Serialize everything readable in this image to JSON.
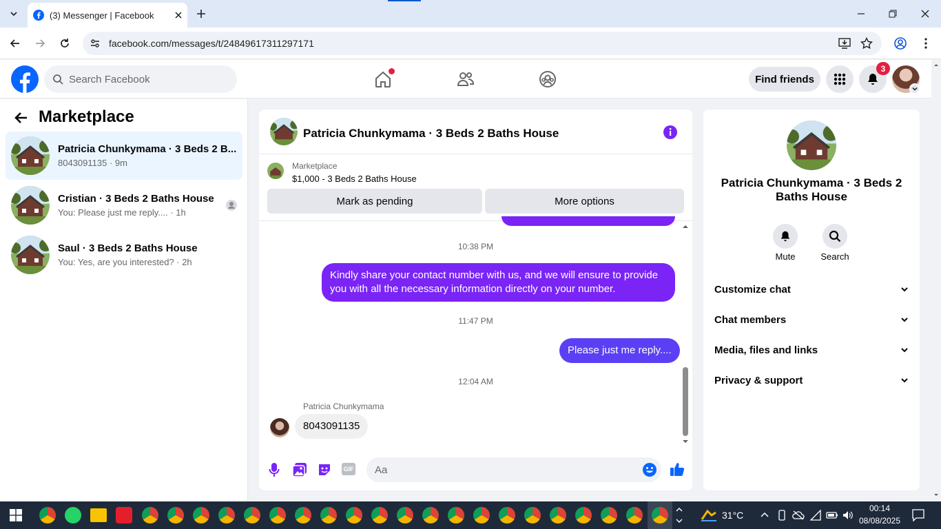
{
  "browser": {
    "tab_title": "(3) Messenger | Facebook",
    "url": "facebook.com/messages/t/24849617311297171"
  },
  "header": {
    "search_placeholder": "Search Facebook",
    "find_friends": "Find friends",
    "notification_count": "3"
  },
  "sidebar": {
    "title": "Marketplace",
    "conversations": [
      {
        "title": "Patricia Chunkymama · 3 Beds 2 B...",
        "subtitle": "8043091135 · 9m"
      },
      {
        "title": "Cristian · 3 Beds 2 Baths House",
        "subtitle": "You: Please just me reply.... · 1h"
      },
      {
        "title": "Saul · 3 Beds 2 Baths House",
        "subtitle": "You: Yes, are you interested? · 2h"
      }
    ]
  },
  "chat": {
    "title": "Patricia Chunkymama · 3 Beds 2 Baths House",
    "listing_source": "Marketplace",
    "listing_text": "$1,000 - 3 Beds 2 Baths House",
    "mark_pending": "Mark as pending",
    "more_options": "More options",
    "messages": [
      {
        "time": "10:38 PM",
        "text": "Kindly share your contact number with us, and we will ensure to provide you with all the necessary information directly on your number."
      },
      {
        "time": "11:47 PM",
        "text": "Please just me reply...."
      },
      {
        "time": "12:04 AM",
        "sender": "Patricia Chunkymama",
        "text": "8043091135"
      }
    ],
    "composer_placeholder": "Aa"
  },
  "info": {
    "name": "Patricia Chunkymama · 3 Beds 2 Baths House",
    "mute": "Mute",
    "search": "Search",
    "sections": [
      "Customize chat",
      "Chat members",
      "Media, files and links",
      "Privacy & support"
    ]
  },
  "taskbar": {
    "weather": "31°C",
    "time": "00:14",
    "date": "08/08/2025"
  },
  "colors": {
    "messenger_purple": "#7a25f6",
    "facebook_blue": "#0866ff",
    "notification_red": "#e41e3f"
  }
}
